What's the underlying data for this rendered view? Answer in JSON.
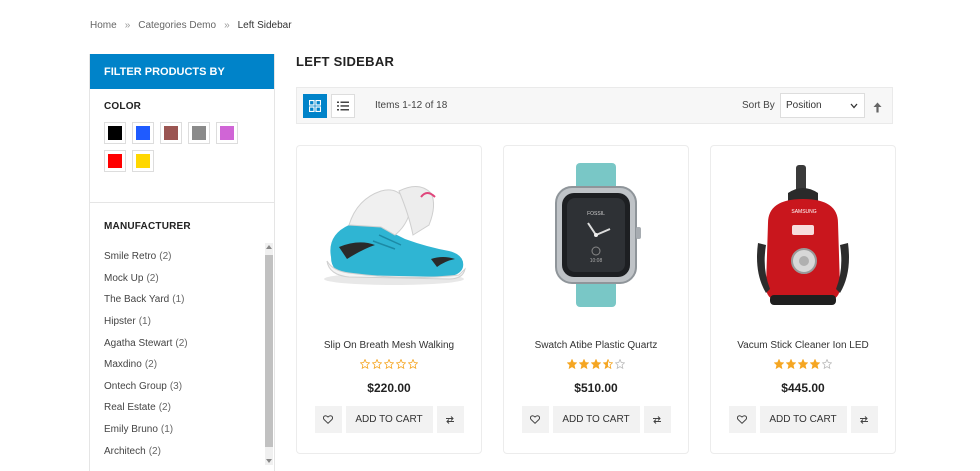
{
  "breadcrumb": {
    "items": [
      "Home",
      "Categories Demo",
      "Left Sidebar"
    ],
    "separator": "»"
  },
  "sidebar": {
    "header": "FILTER PRODUCTS BY",
    "color": {
      "title": "COLOR",
      "swatches": [
        "#000000",
        "#1f5bff",
        "#9b5552",
        "#8a8a8a",
        "#d065d6",
        "#ff0000",
        "#ffd700"
      ]
    },
    "manufacturer": {
      "title": "MANUFACTURER",
      "items": [
        {
          "name": "Smile Retro",
          "count": "(2)"
        },
        {
          "name": "Mock Up",
          "count": "(2)"
        },
        {
          "name": "The Back Yard",
          "count": "(1)"
        },
        {
          "name": "Hipster",
          "count": "(1)"
        },
        {
          "name": "Agatha Stewart",
          "count": "(2)"
        },
        {
          "name": "Maxdino",
          "count": "(2)"
        },
        {
          "name": "Ontech Group",
          "count": "(3)"
        },
        {
          "name": "Real Estate",
          "count": "(2)"
        },
        {
          "name": "Emily Bruno",
          "count": "(1)"
        },
        {
          "name": "Architech",
          "count": "(2)"
        }
      ]
    }
  },
  "main": {
    "title": "LEFT SIDEBAR",
    "toolbar": {
      "items_count": "Items 1-12 of 18",
      "sort_label": "Sort By",
      "sort_value": "Position"
    },
    "products": [
      {
        "name": "Slip On Breath Mesh Walking",
        "price": "$220.00",
        "rating": 0,
        "image": "sneaker"
      },
      {
        "name": "Swatch Atibe Plastic Quartz",
        "price": "$510.00",
        "rating": 3.5,
        "image": "smartwatch"
      },
      {
        "name": "Vacum Stick Cleaner Ion LED",
        "price": "$445.00",
        "rating": 4,
        "image": "vacuum"
      }
    ],
    "add_to_cart_label": "ADD TO CART",
    "watch_face": {
      "brand": "FOSSIL",
      "time": "10:08"
    },
    "vacuum_brand": "SAMSUNG"
  },
  "colors": {
    "accent": "#0083c9",
    "star": "#f5a623"
  }
}
